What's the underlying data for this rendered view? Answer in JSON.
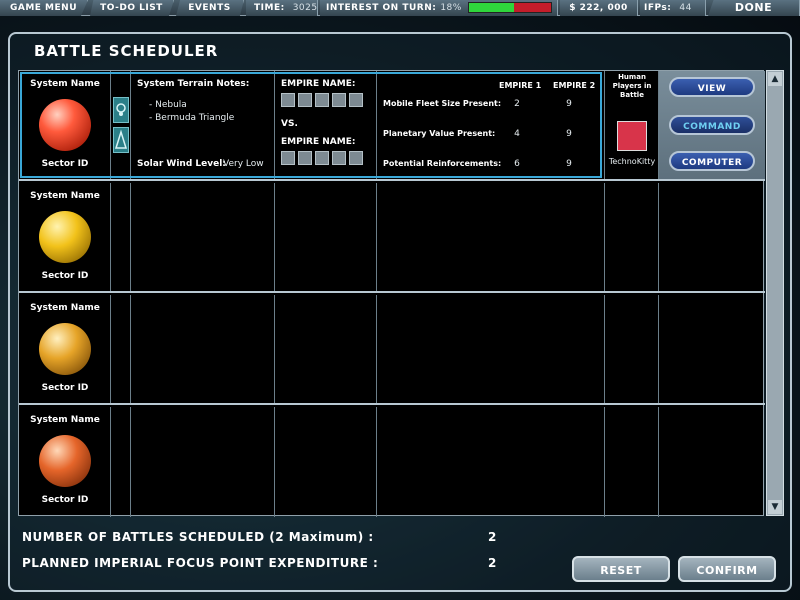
{
  "topbar": {
    "game_menu": "GAME MENU",
    "todo": "TO-DO LIST",
    "events": "EVENTS",
    "time_label": "TIME:",
    "time_value": "3025",
    "interest_label": "INTEREST ON TURN:",
    "interest_value": "18%",
    "interest_fill_fraction": 0.55,
    "money": "$ 222, 000",
    "ifp_label": "IFPs:",
    "ifp_value": "44",
    "done": "DONE"
  },
  "title": "BATTLE SCHEDULER",
  "rows": [
    {
      "system_name": "System Name",
      "sector_id": "Sector ID",
      "planet_color": "#ff5a3c",
      "terrain_title": "System Terrain Notes:",
      "terrain_items": [
        "- Nebula",
        "- Bermuda Triangle"
      ],
      "wind_label": "Solar Wind Level:",
      "wind_value": "Very Low",
      "empire_label": "EMPIRE NAME:",
      "vs": "VS.",
      "empire1_header": "EMPIRE 1",
      "empire2_header": "EMPIRE 2",
      "stats": [
        {
          "label": "Mobile Fleet Size Present:",
          "e1": "2",
          "e2": "9"
        },
        {
          "label": "Planetary Value Present:",
          "e1": "4",
          "e2": "9"
        },
        {
          "label": "Potential Reinforcements:",
          "e1": "6",
          "e2": "9"
        }
      ],
      "human_title": "Human Players in Battle",
      "human_color": "#d8344a",
      "human_name": "TechnoKitty",
      "buttons": [
        "VIEW",
        "COMMAND",
        "COMPUTER"
      ]
    },
    {
      "system_name": "System Name",
      "sector_id": "Sector ID",
      "planet_color": "#f2c21a"
    },
    {
      "system_name": "System Name",
      "sector_id": "Sector ID",
      "planet_color": "#e6a428"
    },
    {
      "system_name": "System Name",
      "sector_id": "Sector ID",
      "planet_color": "#e5652a"
    }
  ],
  "footer": {
    "battles_label": "NUMBER OF BATTLES SCHEDULED (2 Maximum) :",
    "battles_value": "2",
    "ifp_label": "PLANNED IMPERIAL FOCUS POINT EXPENDITURE :",
    "ifp_value": "2",
    "reset": "RESET",
    "confirm": "CONFIRM"
  },
  "colors": {
    "accent_blue": "#3aa8d8",
    "button_blue": "#1e3a80"
  }
}
